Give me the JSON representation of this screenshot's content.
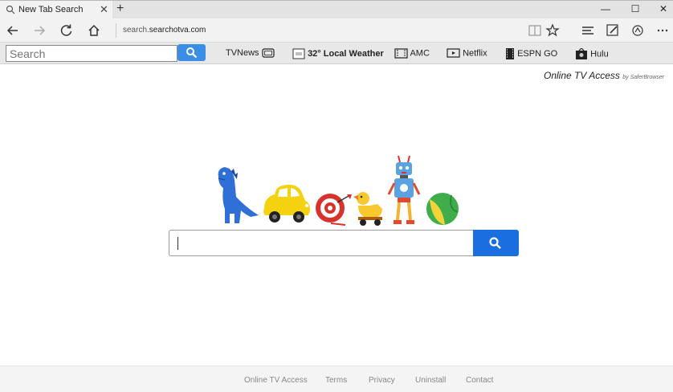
{
  "browser": {
    "tab_title": "New Tab Search",
    "tab_close": "✕",
    "new_tab": "+",
    "window_controls": [
      "—",
      "☐",
      "✕"
    ],
    "address_prefix": "search.",
    "address_domain": "searchotva.com"
  },
  "toolbar": {
    "search_placeholder": "Search",
    "links": [
      {
        "label": "TVNews",
        "icon": "tv-icon"
      },
      {
        "label": "32° Local Weather",
        "icon": "weather-icon"
      },
      {
        "label": "AMC",
        "icon": "amc-icon"
      },
      {
        "label": "Netflix",
        "icon": "netflix-icon"
      },
      {
        "label": "ESPN GO",
        "icon": "film-icon"
      },
      {
        "label": "Hulu",
        "icon": "hulu-icon"
      }
    ]
  },
  "brand": {
    "name": "Online TV Access",
    "by": "by SaferBrowser"
  },
  "footer": {
    "links": [
      "Online TV Access",
      "Terms",
      "Privacy",
      "Uninstall",
      "Contact"
    ]
  },
  "colors": {
    "accent": "#1a6ee0",
    "toolbar_button": "#3a8ee6"
  }
}
